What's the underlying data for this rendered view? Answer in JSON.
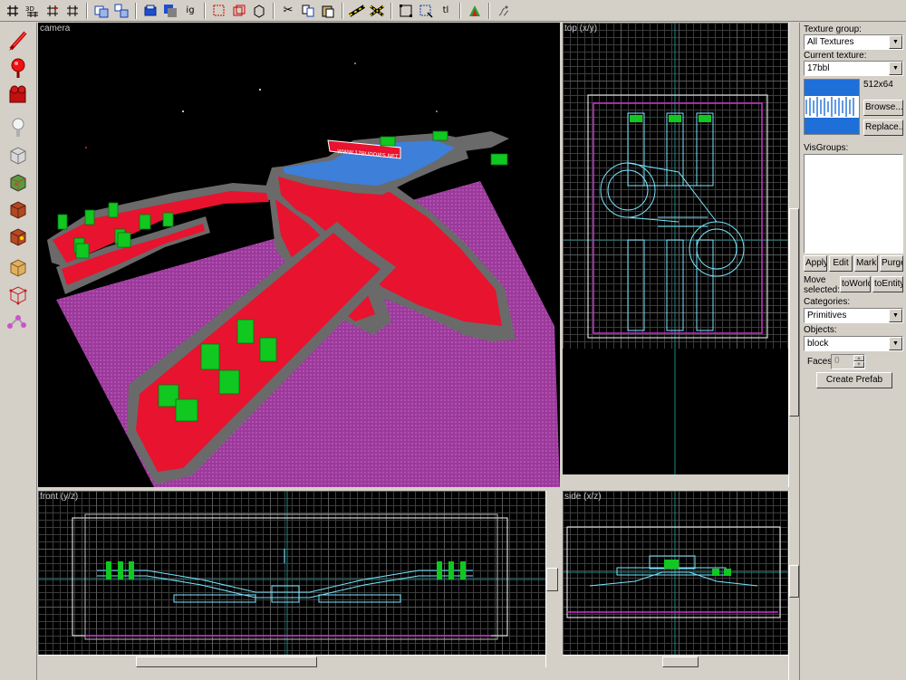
{
  "toolbar": {
    "icons": [
      "grid-icon",
      "3d-grid-icon",
      "snap-grid-icon",
      "grid-size-icon",
      "carve-icon",
      "group-icon",
      "ungroup-icon",
      "texture-lock-icon",
      "texture-icon",
      "ignore-groups-icon",
      "hide-icon",
      "show-icon",
      "cut-icon",
      "copy-icon",
      "paste-icon",
      "clip-icon",
      "vertex-icon",
      "select-icon",
      "zoom-icon",
      "transform-icon",
      "texture-app-icon",
      "run-map-icon"
    ],
    "ignore_label": "ig",
    "tl_label": "tl"
  },
  "palette": {
    "tools": [
      "selection-tool-icon",
      "magnify-tool-icon",
      "camera-tool-icon",
      "entity-tool-icon",
      "block-tool-icon",
      "texture-application-icon",
      "apply-decals-icon",
      "overlays-icon",
      "clipping-tool-icon",
      "vertex-tool-icon",
      "path-tool-icon"
    ]
  },
  "viewports": {
    "camera": {
      "label": "camera"
    },
    "top": {
      "label": "top (x/y)"
    },
    "front": {
      "label": "front (y/z)"
    },
    "side": {
      "label": "side (x/z)"
    }
  },
  "colors": {
    "floor": "#9b3a9b",
    "road": "#e8132e",
    "wall": "#6a6a6a",
    "water": "#3d7fd9",
    "blocks": "#10c820",
    "wire": "#78e6ff"
  },
  "panel": {
    "texture_group_label": "Texture group:",
    "texture_group_value": "All Textures",
    "current_texture_label": "Current texture:",
    "current_texture_value": "17bbl",
    "texture_size": "512x64",
    "browse_label": "Browse...",
    "replace_label": "Replace...",
    "visgroups_label": "VisGroups:",
    "apply_label": "Apply",
    "edit_label": "Edit",
    "mark_label": "Mark",
    "purge_label": "Purge",
    "move_selected_label": "Move selected:",
    "to_world_label": "toWorld",
    "to_entity_label": "toEntity",
    "categories_label": "Categories:",
    "categories_value": "Primitives",
    "objects_label": "Objects:",
    "objects_value": "block",
    "faces_label": "Faces:",
    "faces_value": "0",
    "create_prefab_label": "Create Prefab"
  }
}
